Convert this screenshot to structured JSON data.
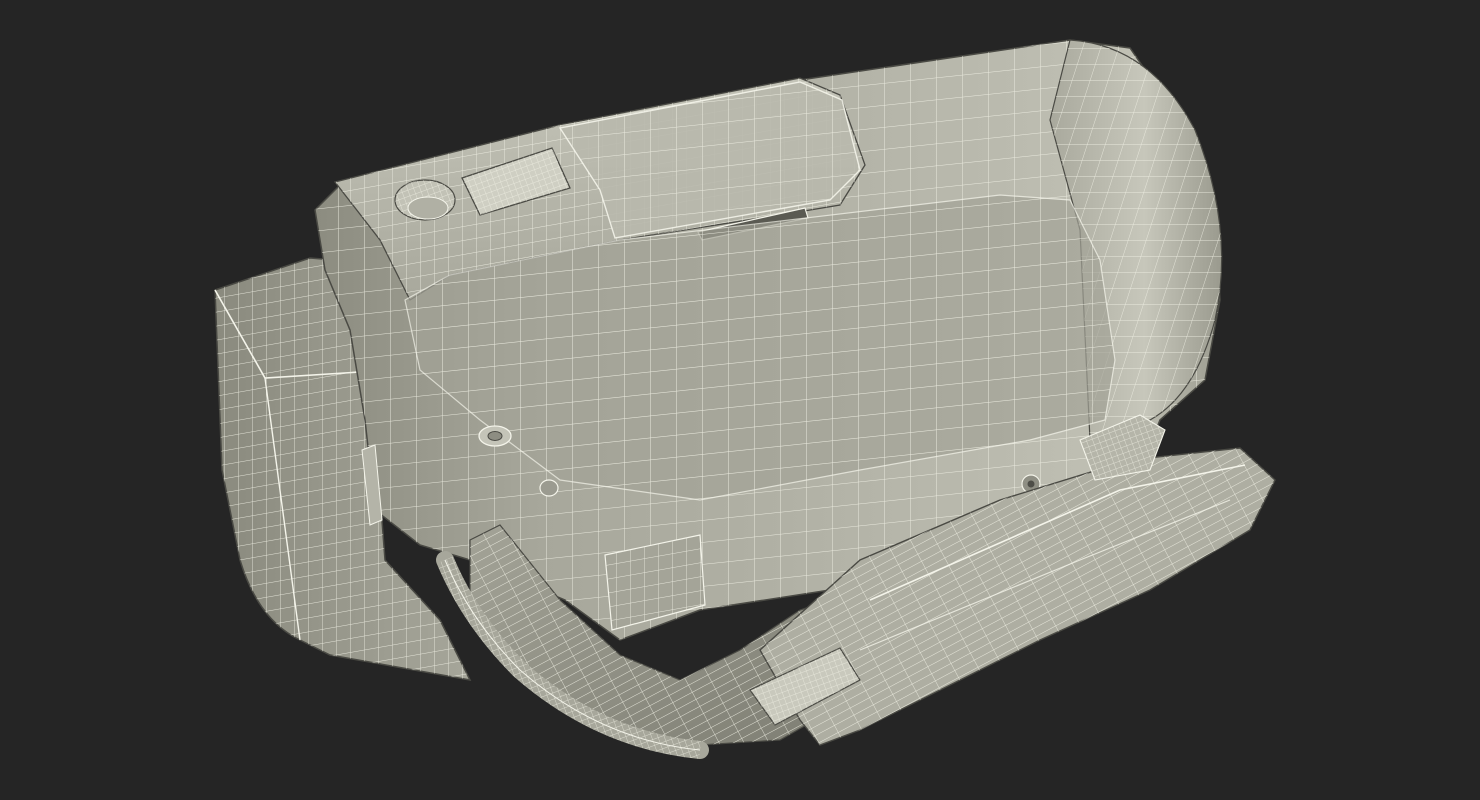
{
  "scene": {
    "subject": "camcorder-wireframe-model",
    "colors": {
      "background": "#252525",
      "surface_light": "#bcbcb0",
      "surface_mid": "#9c9c90",
      "surface_dark": "#6f6f66",
      "wire": "#f4f4ea",
      "edge": "#4a4a44"
    }
  }
}
